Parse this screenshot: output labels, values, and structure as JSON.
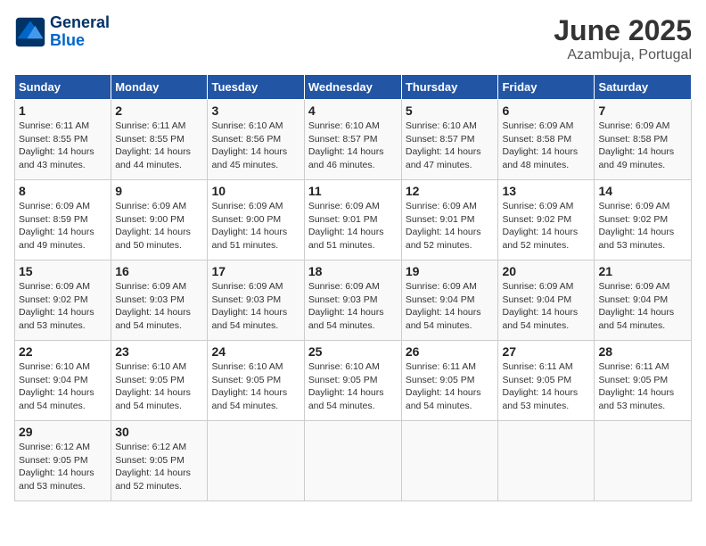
{
  "header": {
    "logo_line1": "General",
    "logo_line2": "Blue",
    "month": "June 2025",
    "location": "Azambuja, Portugal"
  },
  "weekdays": [
    "Sunday",
    "Monday",
    "Tuesday",
    "Wednesday",
    "Thursday",
    "Friday",
    "Saturday"
  ],
  "weeks": [
    [
      {
        "day": "1",
        "info": "Sunrise: 6:11 AM\nSunset: 8:55 PM\nDaylight: 14 hours\nand 43 minutes."
      },
      {
        "day": "2",
        "info": "Sunrise: 6:11 AM\nSunset: 8:55 PM\nDaylight: 14 hours\nand 44 minutes."
      },
      {
        "day": "3",
        "info": "Sunrise: 6:10 AM\nSunset: 8:56 PM\nDaylight: 14 hours\nand 45 minutes."
      },
      {
        "day": "4",
        "info": "Sunrise: 6:10 AM\nSunset: 8:57 PM\nDaylight: 14 hours\nand 46 minutes."
      },
      {
        "day": "5",
        "info": "Sunrise: 6:10 AM\nSunset: 8:57 PM\nDaylight: 14 hours\nand 47 minutes."
      },
      {
        "day": "6",
        "info": "Sunrise: 6:09 AM\nSunset: 8:58 PM\nDaylight: 14 hours\nand 48 minutes."
      },
      {
        "day": "7",
        "info": "Sunrise: 6:09 AM\nSunset: 8:58 PM\nDaylight: 14 hours\nand 49 minutes."
      }
    ],
    [
      {
        "day": "8",
        "info": "Sunrise: 6:09 AM\nSunset: 8:59 PM\nDaylight: 14 hours\nand 49 minutes."
      },
      {
        "day": "9",
        "info": "Sunrise: 6:09 AM\nSunset: 9:00 PM\nDaylight: 14 hours\nand 50 minutes."
      },
      {
        "day": "10",
        "info": "Sunrise: 6:09 AM\nSunset: 9:00 PM\nDaylight: 14 hours\nand 51 minutes."
      },
      {
        "day": "11",
        "info": "Sunrise: 6:09 AM\nSunset: 9:01 PM\nDaylight: 14 hours\nand 51 minutes."
      },
      {
        "day": "12",
        "info": "Sunrise: 6:09 AM\nSunset: 9:01 PM\nDaylight: 14 hours\nand 52 minutes."
      },
      {
        "day": "13",
        "info": "Sunrise: 6:09 AM\nSunset: 9:02 PM\nDaylight: 14 hours\nand 52 minutes."
      },
      {
        "day": "14",
        "info": "Sunrise: 6:09 AM\nSunset: 9:02 PM\nDaylight: 14 hours\nand 53 minutes."
      }
    ],
    [
      {
        "day": "15",
        "info": "Sunrise: 6:09 AM\nSunset: 9:02 PM\nDaylight: 14 hours\nand 53 minutes."
      },
      {
        "day": "16",
        "info": "Sunrise: 6:09 AM\nSunset: 9:03 PM\nDaylight: 14 hours\nand 54 minutes."
      },
      {
        "day": "17",
        "info": "Sunrise: 6:09 AM\nSunset: 9:03 PM\nDaylight: 14 hours\nand 54 minutes."
      },
      {
        "day": "18",
        "info": "Sunrise: 6:09 AM\nSunset: 9:03 PM\nDaylight: 14 hours\nand 54 minutes."
      },
      {
        "day": "19",
        "info": "Sunrise: 6:09 AM\nSunset: 9:04 PM\nDaylight: 14 hours\nand 54 minutes."
      },
      {
        "day": "20",
        "info": "Sunrise: 6:09 AM\nSunset: 9:04 PM\nDaylight: 14 hours\nand 54 minutes."
      },
      {
        "day": "21",
        "info": "Sunrise: 6:09 AM\nSunset: 9:04 PM\nDaylight: 14 hours\nand 54 minutes."
      }
    ],
    [
      {
        "day": "22",
        "info": "Sunrise: 6:10 AM\nSunset: 9:04 PM\nDaylight: 14 hours\nand 54 minutes."
      },
      {
        "day": "23",
        "info": "Sunrise: 6:10 AM\nSunset: 9:05 PM\nDaylight: 14 hours\nand 54 minutes."
      },
      {
        "day": "24",
        "info": "Sunrise: 6:10 AM\nSunset: 9:05 PM\nDaylight: 14 hours\nand 54 minutes."
      },
      {
        "day": "25",
        "info": "Sunrise: 6:10 AM\nSunset: 9:05 PM\nDaylight: 14 hours\nand 54 minutes."
      },
      {
        "day": "26",
        "info": "Sunrise: 6:11 AM\nSunset: 9:05 PM\nDaylight: 14 hours\nand 54 minutes."
      },
      {
        "day": "27",
        "info": "Sunrise: 6:11 AM\nSunset: 9:05 PM\nDaylight: 14 hours\nand 53 minutes."
      },
      {
        "day": "28",
        "info": "Sunrise: 6:11 AM\nSunset: 9:05 PM\nDaylight: 14 hours\nand 53 minutes."
      }
    ],
    [
      {
        "day": "29",
        "info": "Sunrise: 6:12 AM\nSunset: 9:05 PM\nDaylight: 14 hours\nand 53 minutes."
      },
      {
        "day": "30",
        "info": "Sunrise: 6:12 AM\nSunset: 9:05 PM\nDaylight: 14 hours\nand 52 minutes."
      },
      {
        "day": "",
        "info": ""
      },
      {
        "day": "",
        "info": ""
      },
      {
        "day": "",
        "info": ""
      },
      {
        "day": "",
        "info": ""
      },
      {
        "day": "",
        "info": ""
      }
    ]
  ]
}
